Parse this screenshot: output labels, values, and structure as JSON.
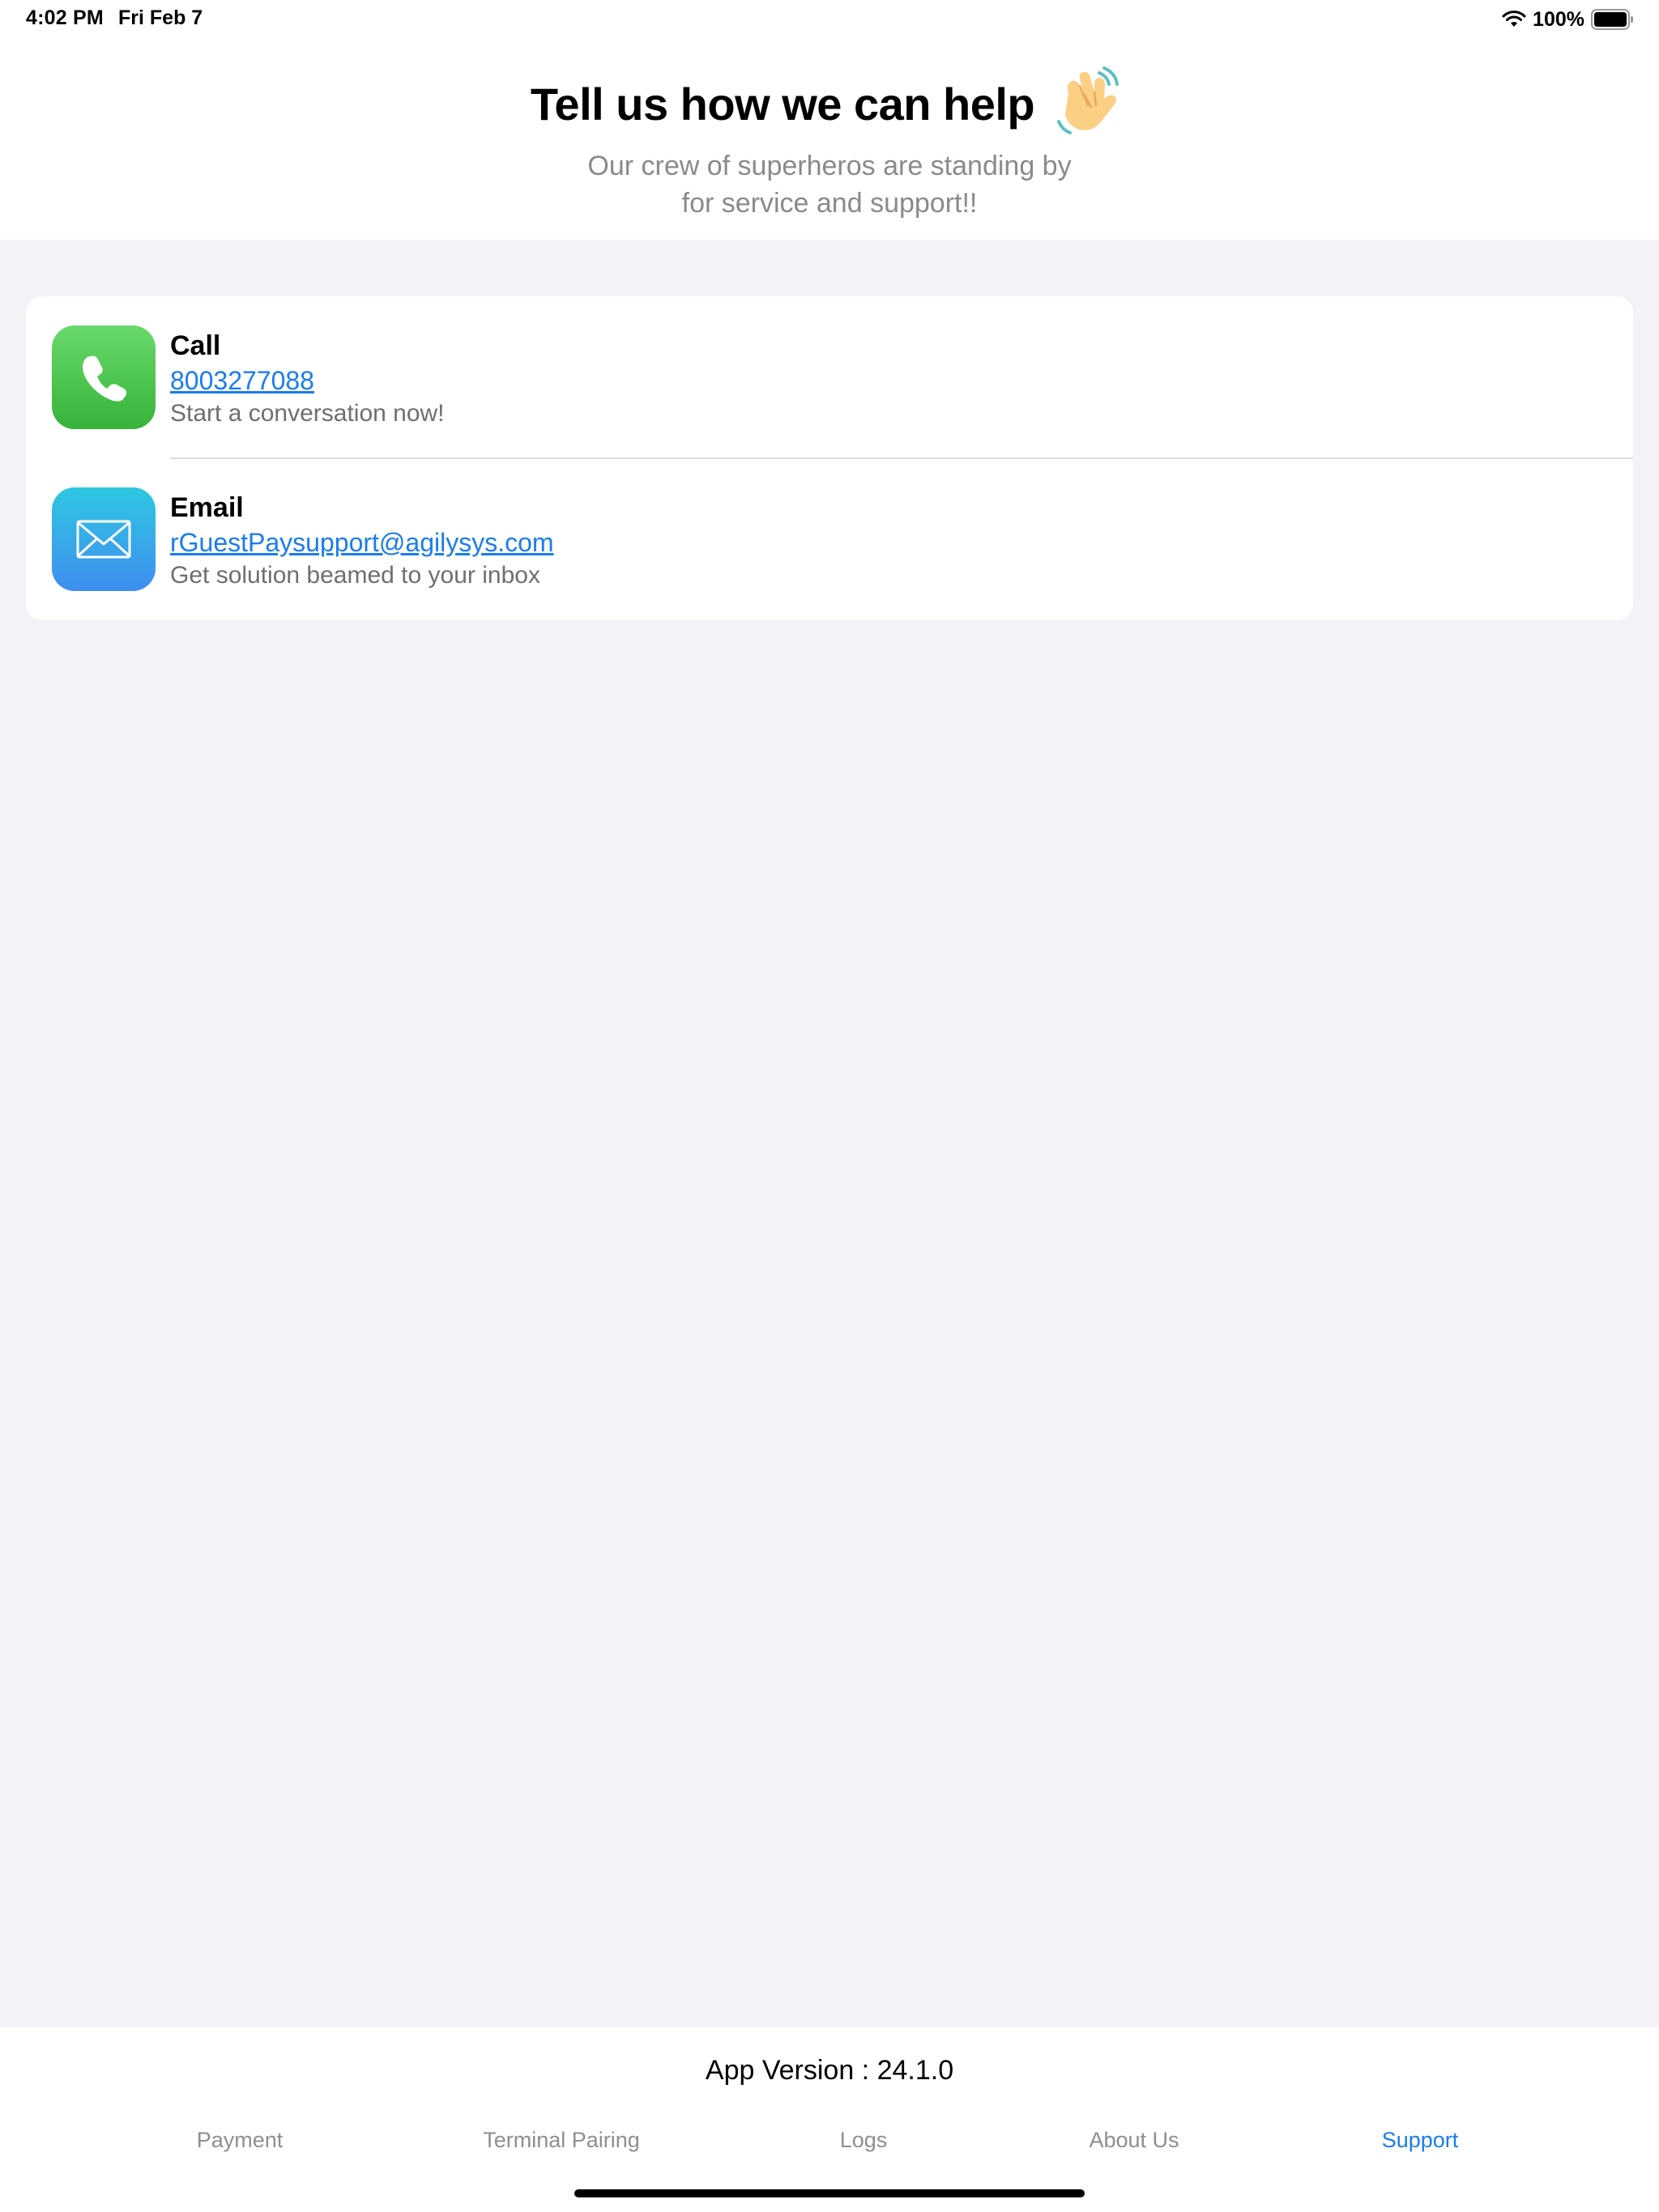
{
  "status_bar": {
    "time": "4:02 PM",
    "date": "Fri Feb 7",
    "battery_percent": "100%",
    "battery_level": 1.0
  },
  "header": {
    "title": "Tell us how we can help",
    "subtitle_line1": "Our crew of superheros are standing by",
    "subtitle_line2": "for service and support!!",
    "emoji_icon": "waving-hand-icon"
  },
  "contacts": {
    "call": {
      "title": "Call",
      "link": "8003277088",
      "description": "Start a conversation now!",
      "icon": "phone-icon"
    },
    "email": {
      "title": "Email",
      "link": "rGuestPaysupport@agilysys.com",
      "description": "Get solution beamed to your inbox",
      "icon": "mail-icon"
    }
  },
  "footer": {
    "app_version": "App Version : 24.1.0"
  },
  "tabs": [
    {
      "label": "Payment",
      "active": false
    },
    {
      "label": "Terminal Pairing",
      "active": false
    },
    {
      "label": "Logs",
      "active": false
    },
    {
      "label": "About Us",
      "active": false
    },
    {
      "label": "Support",
      "active": true
    }
  ],
  "colors": {
    "accent": "#1a7cf0",
    "background": "#f2f2f7",
    "secondary_text": "#8a8a8e"
  }
}
